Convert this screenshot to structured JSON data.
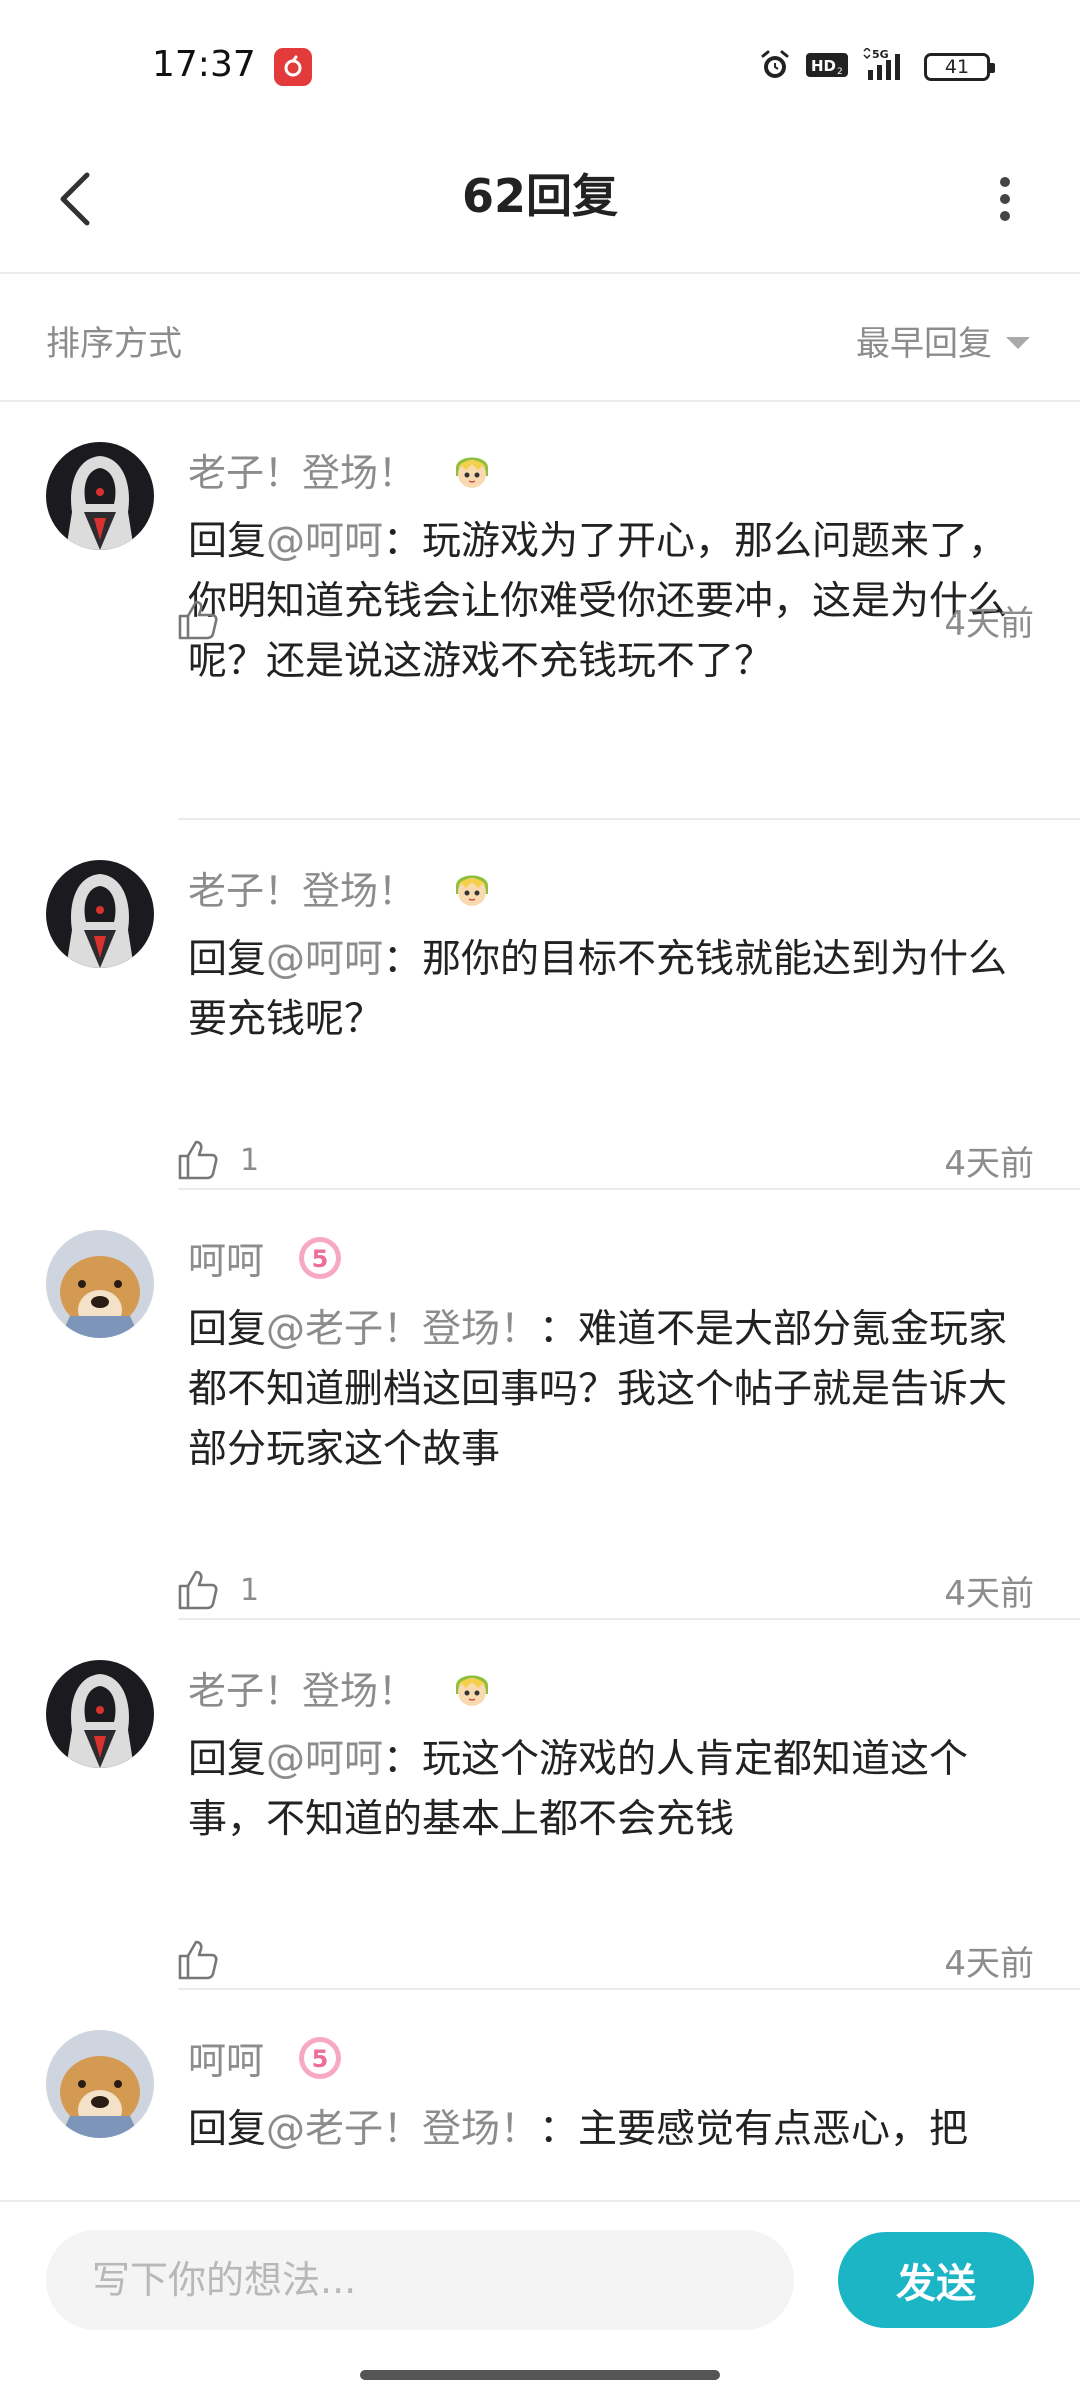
{
  "status_bar": {
    "time": "17:37",
    "battery": "41",
    "hd_label": "HD₂",
    "network": "5G"
  },
  "nav": {
    "title": "62回复"
  },
  "sort": {
    "label": "排序方式",
    "value": "最早回复"
  },
  "replies": [
    {
      "author": "老子！登场！",
      "prefix": "回复",
      "mention": "@呵呵",
      "sep": "：",
      "text": "玩游戏为了开心，那么问题来了，你明知道充钱会让你难受你还要冲，这是为什么呢？还是说这游戏不充钱玩不了？",
      "likes": "",
      "time": "4天前"
    },
    {
      "author": "老子！登场！",
      "prefix": "回复",
      "mention": "@呵呵",
      "sep": "：",
      "text": "那你的目标不充钱就能达到为什么要充钱呢？",
      "likes": "1",
      "time": "4天前"
    },
    {
      "author": "呵呵",
      "prefix": "回复",
      "mention": "@老子！登场！",
      "sep": "：",
      "text": "难道不是大部分氪金玩家都不知道删档这回事吗？我这个帖子就是告诉大部分玩家这个故事",
      "likes": "1",
      "time": "4天前"
    },
    {
      "author": "老子！登场！",
      "prefix": "回复",
      "mention": "@呵呵",
      "sep": "：",
      "text": "玩这个游戏的人肯定都知道这个事，不知道的基本上都不会充钱",
      "likes": "",
      "time": "4天前"
    },
    {
      "author": "呵呵",
      "prefix": "回复",
      "mention": "@老子！登场！",
      "sep": "：",
      "text": "主要感觉有点恶心，把",
      "likes": "",
      "time": ""
    }
  ],
  "composer": {
    "placeholder": "写下你的想法...",
    "send_label": "发送"
  },
  "colors": {
    "accent": "#1bb5c5",
    "muted_text": "#8c8c8c",
    "divider": "#ececec"
  }
}
